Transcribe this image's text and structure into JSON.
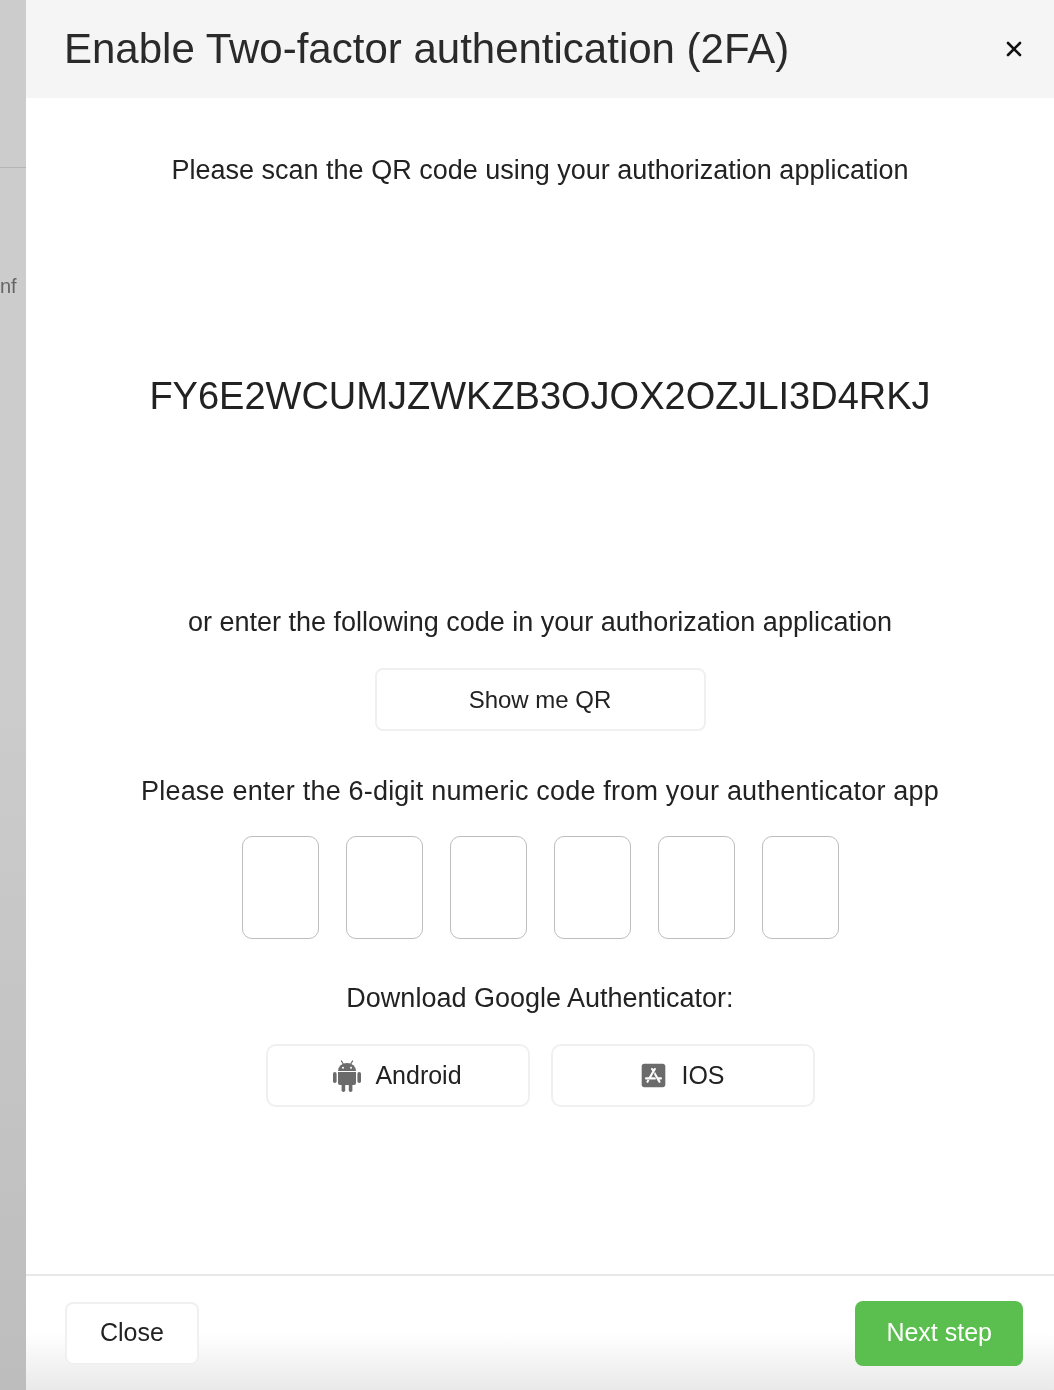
{
  "backdrop": {
    "text_fragment": "nf"
  },
  "dialog": {
    "title": "Enable Two-factor authentication (2FA)",
    "scan_prompt": "Please scan the QR code using your authorization application",
    "secret_code": "FY6E2WCUMJZWKZB3OJOX2OZJLI3D4RKJ",
    "alt_prompt": "or enter the following code in your authorization application",
    "show_qr_button": "Show me QR",
    "code_prompt": "Please enter the 6-digit numeric code from your authenticator app",
    "code_inputs": [
      {
        "focused": false
      },
      {
        "focused": false
      },
      {
        "focused": false
      },
      {
        "focused": false
      },
      {
        "focused": false
      },
      {
        "focused": false
      }
    ],
    "download_label": "Download Google Authenticator:",
    "download_buttons": [
      {
        "kind": "android",
        "label": "Android"
      },
      {
        "kind": "ios",
        "label": "IOS"
      }
    ],
    "footer_buttons": [
      {
        "kind": "secondary",
        "label": "Close"
      },
      {
        "kind": "primary",
        "label": "Next step"
      }
    ]
  }
}
